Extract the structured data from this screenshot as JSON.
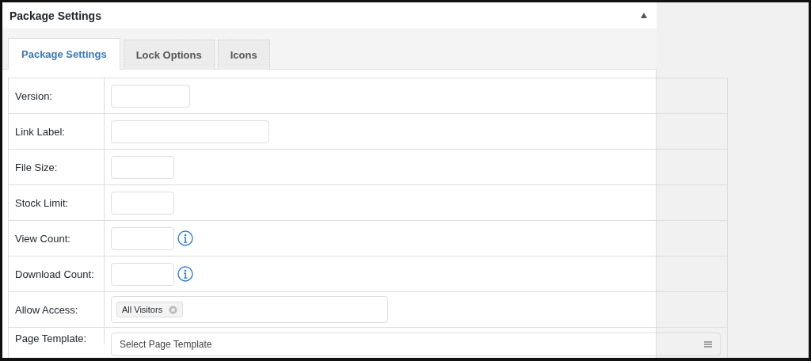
{
  "panel": {
    "title": "Package Settings",
    "expanded": true
  },
  "tabs": [
    {
      "label": "Package Settings",
      "selected": true
    },
    {
      "label": "Lock Options",
      "selected": false
    },
    {
      "label": "Icons",
      "selected": false
    }
  ],
  "rows": [
    {
      "label": "Version:",
      "kind": "text",
      "info": false
    },
    {
      "label": "Link Label:",
      "kind": "text",
      "info": false
    },
    {
      "label": "File Size:",
      "kind": "text",
      "info": false
    },
    {
      "label": "Stock Limit:",
      "kind": "text",
      "info": false
    },
    {
      "label": "View Count:",
      "kind": "text",
      "info": true
    },
    {
      "label": "Download Count:",
      "kind": "text",
      "info": true
    },
    {
      "label": "Allow Access:",
      "kind": "tags",
      "tags": [
        "All Visitors"
      ]
    },
    {
      "label": "Page Template:",
      "kind": "select",
      "placeholder": "Select Page Template"
    }
  ]
}
